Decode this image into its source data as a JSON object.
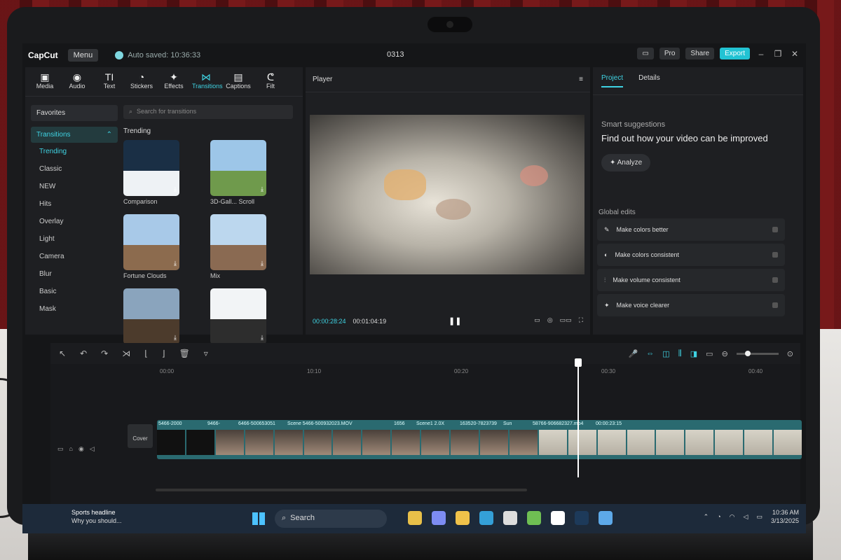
{
  "app": {
    "logo": "CapCut",
    "menu": "Menu",
    "autosave": "Auto saved: 10:36:33",
    "title": "0313"
  },
  "topbar": {
    "pro": "Pro",
    "share": "Share",
    "export": "Export"
  },
  "tools": [
    {
      "label": "Media",
      "icon": "▣"
    },
    {
      "label": "Audio",
      "icon": "◉"
    },
    {
      "label": "Text",
      "icon": "TI"
    },
    {
      "label": "Stickers",
      "icon": "◔"
    },
    {
      "label": "Effects",
      "icon": "✦"
    },
    {
      "label": "Transitions",
      "icon": "⋈"
    },
    {
      "label": "Captions",
      "icon": "▤"
    },
    {
      "label": "Filt",
      "icon": "ᕦ"
    }
  ],
  "sidebar": {
    "favorites": "Favorites",
    "category": "Transitions",
    "items": [
      "Trending",
      "Classic",
      "NEW",
      "Hits",
      "Overlay",
      "Light",
      "Camera",
      "Blur",
      "Basic",
      "Mask"
    ]
  },
  "search_placeholder": "Search for transitions",
  "trending_heading": "Trending",
  "thumbnails": [
    {
      "label": "Comparison",
      "colors": [
        "#1a2f45",
        "#eef2f5"
      ]
    },
    {
      "label": "3D-Gall... Scroll",
      "colors": [
        "#9dc6e8",
        "#6f9a4c"
      ]
    },
    {
      "label": "Fortune Clouds",
      "colors": [
        "#a8c9e8",
        "#8c6b4e"
      ]
    },
    {
      "label": "Mix",
      "colors": [
        "#bcd7ee",
        "#8a6a52"
      ]
    },
    {
      "label": "",
      "colors": [
        "#8aa4bd",
        "#4c3b2c"
      ]
    },
    {
      "label": "",
      "colors": [
        "#f2f4f6",
        "#2d2d2d"
      ]
    }
  ],
  "player": {
    "label": "Player",
    "time_current": "00:00:28:24",
    "time_total": "00:01:04:19"
  },
  "rightpanel": {
    "tab_project": "Project",
    "tab_details": "Details",
    "smart": "Smart suggestions",
    "find": "Find out how your video can be improved",
    "analyze": "Analyze",
    "global": "Global edits",
    "items": [
      "Make colors better",
      "Make colors consistent",
      "Make volume consistent",
      "Make voice clearer"
    ]
  },
  "timeline": {
    "ruler": [
      "00:00",
      "10:10",
      "00:20",
      "00:30",
      "00:40"
    ],
    "cover": "Cover",
    "clip_labels": [
      "5466-2000",
      "9466-",
      "6466-500653051",
      "Scene 5466-500932023.MOV",
      "1656",
      "Scene1 2.0X",
      "163520-7823739",
      "Sun",
      "58766-906682327.mp4",
      "00:00:23:15"
    ]
  },
  "taskbar": {
    "news_title": "Sports headline",
    "news_sub": "Why you should...",
    "search": "Search",
    "time": "10:36 AM",
    "date": "3/13/2025"
  },
  "colors": {
    "accent": "#3fd3e3",
    "export": "#22c3d3"
  }
}
